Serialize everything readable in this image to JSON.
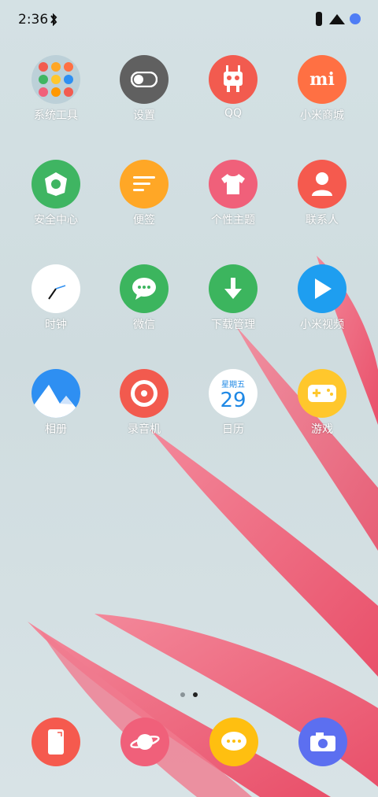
{
  "status_bar": {
    "time": "2:36"
  },
  "apps": [
    {
      "label": "系统工具",
      "icon": "system-tools-folder-icon",
      "color": "#bcd0d8"
    },
    {
      "label": "设置",
      "icon": "settings-toggle-icon",
      "color": "#606060"
    },
    {
      "label": "QQ",
      "icon": "qq-robot-icon",
      "color": "#f25b4f"
    },
    {
      "label": "小米商城",
      "icon": "mi-store-icon",
      "color": "#ff7043",
      "glyph": "mi"
    },
    {
      "label": "安全中心",
      "icon": "security-shield-icon",
      "color": "#3fb562"
    },
    {
      "label": "便签",
      "icon": "notes-icon",
      "color": "#ffa726"
    },
    {
      "label": "个性主题",
      "icon": "themes-shirt-icon",
      "color": "#f0607a"
    },
    {
      "label": "联系人",
      "icon": "contacts-person-icon",
      "color": "#f55a4e"
    },
    {
      "label": "时钟",
      "icon": "clock-icon",
      "color": "#ffffff"
    },
    {
      "label": "微信",
      "icon": "wechat-icon",
      "color": "#3cb55e"
    },
    {
      "label": "下载管理",
      "icon": "download-arrow-icon",
      "color": "#3cb55e"
    },
    {
      "label": "小米视频",
      "icon": "video-play-icon",
      "color": "#1e9ef0"
    },
    {
      "label": "相册",
      "icon": "gallery-mountain-icon",
      "color": "#2e8ff2"
    },
    {
      "label": "录音机",
      "icon": "recorder-icon",
      "color": "#f25a4e"
    },
    {
      "label": "日历",
      "icon": "calendar-icon",
      "color": "#ffffff",
      "weekday": "星期五",
      "day": "29"
    },
    {
      "label": "游戏",
      "icon": "game-controller-icon",
      "color": "#ffc72c"
    }
  ],
  "page_indicator": {
    "count": 2,
    "active": 1
  },
  "dock": [
    {
      "icon": "phone-icon",
      "color": "#f55a4e"
    },
    {
      "icon": "browser-planet-icon",
      "color": "#f0607a"
    },
    {
      "icon": "messages-icon",
      "color": "#ffbf10"
    },
    {
      "icon": "camera-icon",
      "color": "#5c6ff0"
    }
  ]
}
